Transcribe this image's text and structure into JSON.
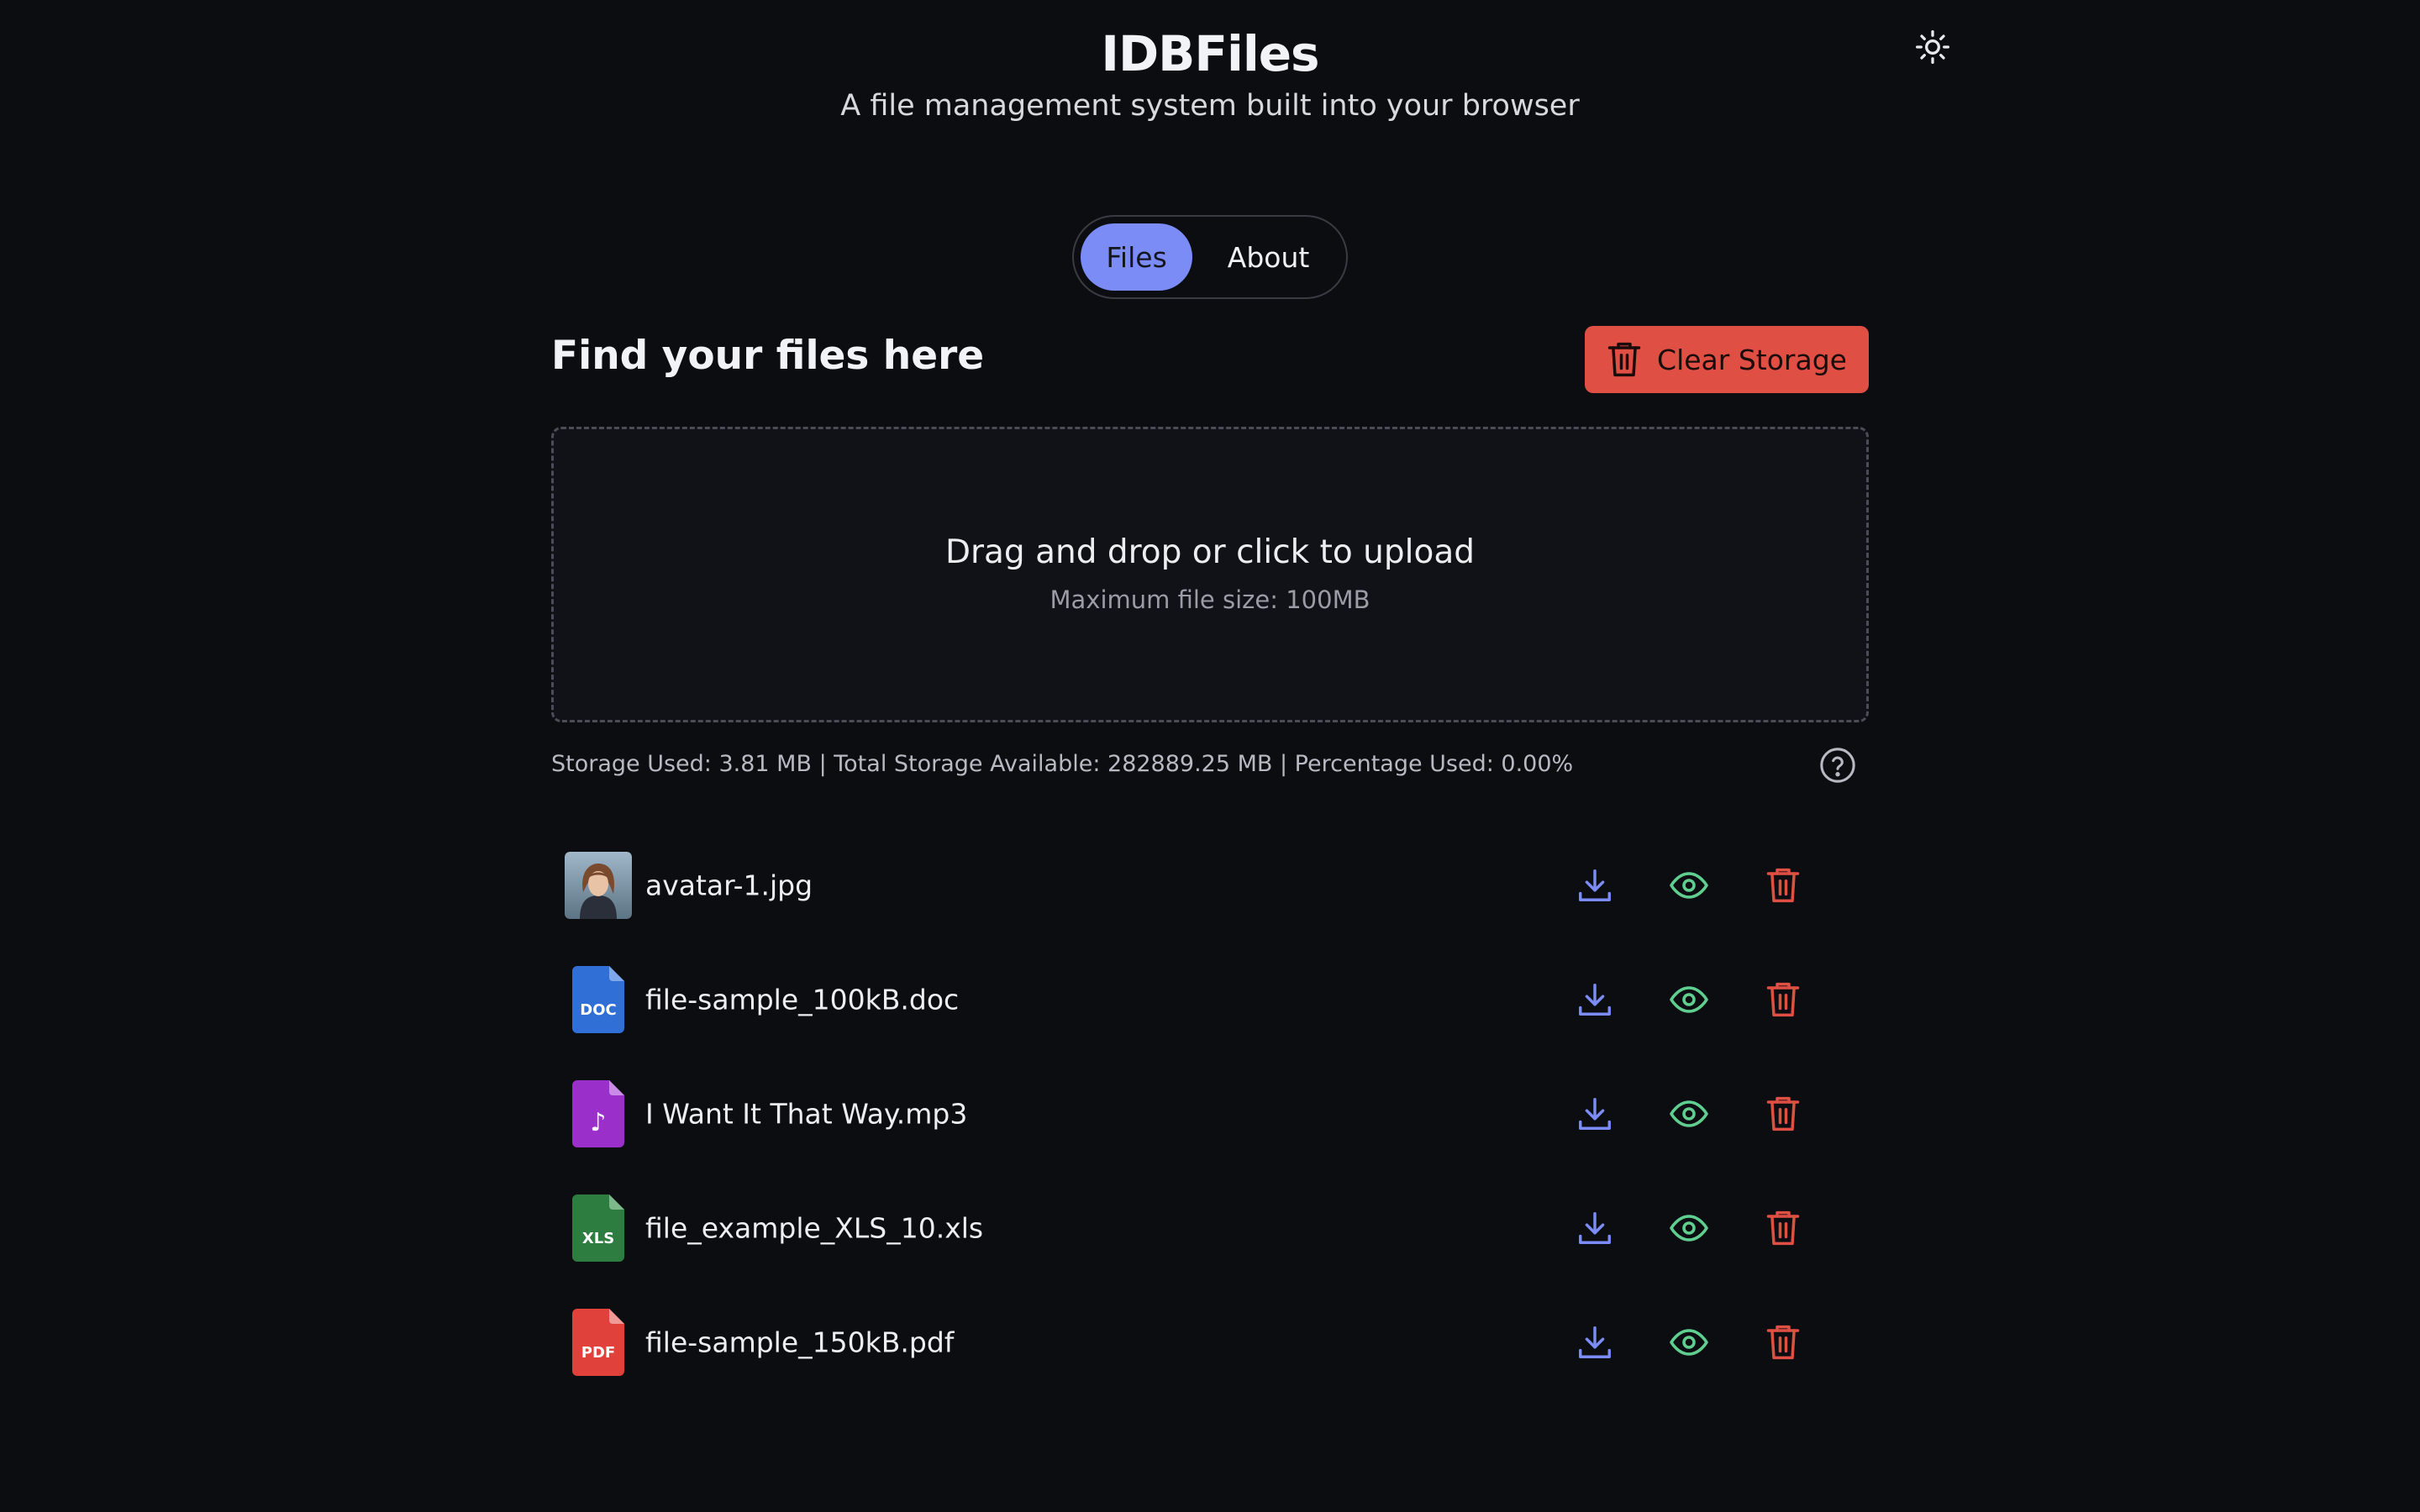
{
  "header": {
    "title": "IDBFiles",
    "subtitle": "A file management system built into your browser"
  },
  "theme_toggle": {
    "icon": "sun-icon"
  },
  "tabs": [
    {
      "label": "Files",
      "active": true
    },
    {
      "label": "About",
      "active": false
    }
  ],
  "main": {
    "section_title": "Find your files here",
    "clear_button_label": "Clear Storage",
    "dropzone": {
      "title": "Drag and drop or click to upload",
      "subtitle": "Maximum file size: 100MB"
    },
    "storage_info": "Storage Used: 3.81 MB | Total Storage Available: 282889.25 MB | Percentage Used: 0.00%"
  },
  "files": [
    {
      "name": "avatar-1.jpg",
      "type": "image",
      "icon": "avatar-thumbnail"
    },
    {
      "name": "file-sample_100kB.doc",
      "type": "doc",
      "icon": "doc-file-icon",
      "badge": "DOC",
      "color": "#2f6fd6"
    },
    {
      "name": "I Want It That Way.mp3",
      "type": "audio",
      "icon": "audio-file-icon",
      "badge": "♪",
      "color": "#9b2fc9"
    },
    {
      "name": "file_example_XLS_10.xls",
      "type": "xls",
      "icon": "xls-file-icon",
      "badge": "XLS",
      "color": "#2e7d40"
    },
    {
      "name": "file-sample_150kB.pdf",
      "type": "pdf",
      "icon": "pdf-file-icon",
      "badge": "PDF",
      "color": "#e0413a"
    }
  ],
  "colors": {
    "accent": "#7b8cf6",
    "danger": "#e04f43",
    "download": "#7b8cf6",
    "view": "#5fcf8f",
    "delete": "#e04f43",
    "background": "#0c0d11"
  }
}
